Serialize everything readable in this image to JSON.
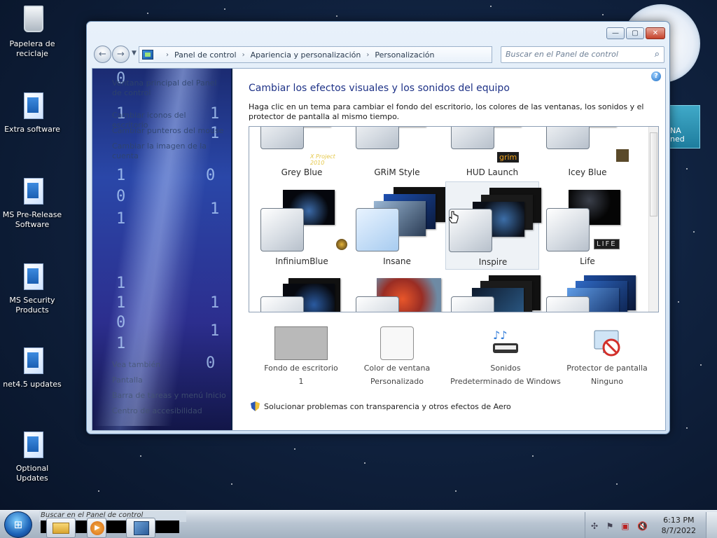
{
  "desktop": {
    "icons": [
      {
        "label": "Papelera de reciclaje",
        "icon": "recycle-bin-icon"
      },
      {
        "label": "Extra software",
        "icon": "folder-icon"
      },
      {
        "label": "MS Pre-Release Software",
        "icon": "folder-icon"
      },
      {
        "label": "MS Security Products",
        "icon": "folder-icon"
      },
      {
        "label": "net4.5 updates",
        "icon": "folder-icon"
      },
      {
        "label": "Optional Updates",
        "icon": "folder-icon"
      }
    ],
    "gadget_text": "NA\nned"
  },
  "window": {
    "controls": {
      "minimize": "—",
      "maximize": "▢",
      "close": "✕"
    },
    "breadcrumbs": [
      "Panel de control",
      "Apariencia y personalización",
      "Personalización"
    ],
    "search_placeholder": "Buscar en el Panel de control"
  },
  "left_pane": {
    "links": [
      "Ventana principal del Panel de control",
      "Cambiar iconos del escritorio",
      "Cambiar punteros del mouse",
      "Cambiar la imagen de la cuenta"
    ],
    "see_also_title": "Vea también",
    "see_also": [
      "Pantalla",
      "Barra de tareas y menú Inicio",
      "Centro de accesibilidad"
    ]
  },
  "main": {
    "title": "Cambiar los efectos visuales y los sonidos del equipo",
    "description": "Haga clic en un tema para cambiar el fondo del escritorio, los colores de las ventanas, los sonidos y el protector de pantalla al mismo tiempo.",
    "themes": [
      {
        "name": "Grey Blue",
        "badge": "X Project 2010"
      },
      {
        "name": "GRiM Style",
        "badge": ""
      },
      {
        "name": "HUD Launch",
        "badge": "grim"
      },
      {
        "name": "Icey Blue",
        "badge": ""
      },
      {
        "name": "InfiniumBlue",
        "badge": ""
      },
      {
        "name": "Insane",
        "badge": ""
      },
      {
        "name": "Inspire",
        "badge": "",
        "selected": true
      },
      {
        "name": "Life",
        "badge": "LIFE"
      }
    ],
    "settings": [
      {
        "label": "Fondo de escritorio",
        "value": "1"
      },
      {
        "label": "Color de ventana",
        "value": "Personalizado"
      },
      {
        "label": "Sonidos",
        "value": "Predeterminado de Windows"
      },
      {
        "label": "Protector de pantalla",
        "value": "Ninguno"
      }
    ],
    "aero_link": "Solucionar problemas con transparencia y otros efectos de Aero"
  },
  "taskbar": {
    "search_text": "Buscar en el Panel de control",
    "time": "6:13 PM",
    "date": "8/7/2022"
  }
}
